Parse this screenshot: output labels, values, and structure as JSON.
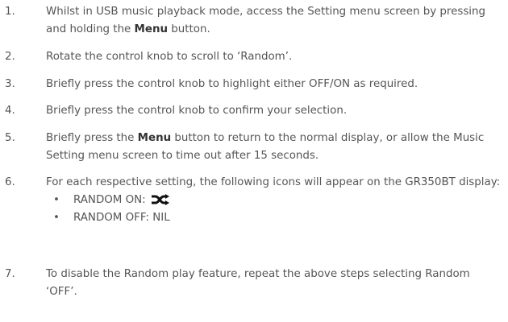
{
  "steps": [
    {
      "num": "1.",
      "pre": "Whilst in USB music playback mode, access the Setting menu screen by pressing and holding the ",
      "bold": "Menu",
      "post": " button."
    },
    {
      "num": "2.",
      "text": "Rotate the control knob to scroll to ‘Random’."
    },
    {
      "num": "3.",
      "text": "Briefly press the control knob to highlight either OFF/ON as required."
    },
    {
      "num": "4.",
      "text": "Briefly press the control knob to confirm your selection."
    },
    {
      "num": "5.",
      "pre": "Briefly press the ",
      "bold": "Menu",
      "post": " button to return to the normal display, or allow the Music Setting menu screen to time out after 15 seconds."
    },
    {
      "num": "6.",
      "text": "For each respective setting, the following icons will appear on the GR350BT display:",
      "bullets": [
        {
          "dot": "•",
          "label": "RANDOM ON:",
          "icon": "shuffle-icon"
        },
        {
          "dot": "•",
          "label": "RANDOM OFF: NIL"
        }
      ]
    },
    {
      "num": "7.",
      "text": "To disable the Random play feature, repeat the above steps selecting Random ‘OFF’."
    }
  ]
}
